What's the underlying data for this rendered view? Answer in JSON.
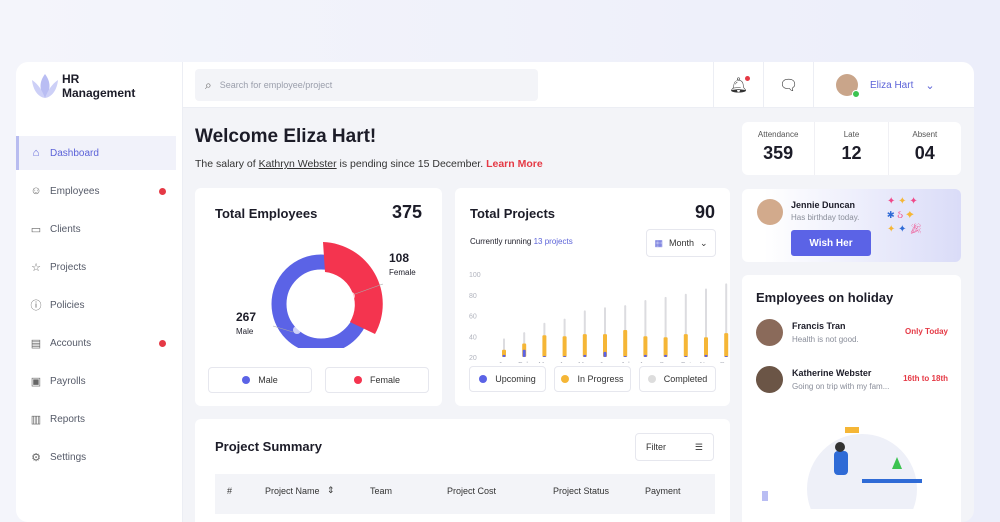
{
  "app": {
    "title_line1": "HR",
    "title_line2": "Management"
  },
  "sidebar": {
    "items": [
      {
        "label": "Dashboard",
        "icon": "home-icon",
        "active": true,
        "badge": false
      },
      {
        "label": "Employees",
        "icon": "user-icon",
        "badge": true
      },
      {
        "label": "Clients",
        "icon": "briefcase-icon",
        "badge": false
      },
      {
        "label": "Projects",
        "icon": "star-icon",
        "badge": false
      },
      {
        "label": "Policies",
        "icon": "info-icon",
        "badge": false
      },
      {
        "label": "Accounts",
        "icon": "wallet-icon",
        "badge": true
      },
      {
        "label": "Payrolls",
        "icon": "money-icon",
        "badge": false
      },
      {
        "label": "Reports",
        "icon": "bar-chart-icon",
        "badge": false
      },
      {
        "label": "Settings",
        "icon": "gear-icon",
        "badge": false
      }
    ]
  },
  "header": {
    "search_placeholder": "Search for employee/project",
    "user_name": "Eliza Hart"
  },
  "welcome": {
    "title": "Welcome Eliza Hart!",
    "msg_pre": "The salary of ",
    "msg_name": "Kathryn Webster",
    "msg_post": " is pending since 15 December. ",
    "learn_more": "Learn More"
  },
  "employees": {
    "title": "Total Employees",
    "total": "375",
    "female_count": "108",
    "female_label": "Female",
    "male_count": "267",
    "male_label": "Male",
    "legend_male": "Male",
    "legend_female": "Female",
    "colors": {
      "male": "#5b63e6",
      "female": "#f4344f"
    }
  },
  "projects": {
    "title": "Total Projects",
    "total": "90",
    "running_pre": "Currently running ",
    "running_link": "13 projects",
    "period": "Month",
    "legend": [
      "Upcoming",
      "In Progress",
      "Completed"
    ]
  },
  "stats": [
    {
      "label": "Attendance",
      "value": "359"
    },
    {
      "label": "Late",
      "value": "12"
    },
    {
      "label": "Absent",
      "value": "04"
    }
  ],
  "birthday": {
    "name": "Jennie Duncan",
    "msg": "Has birthday today.",
    "button": "Wish Her"
  },
  "holiday": {
    "title": "Employees on holiday",
    "items": [
      {
        "name": "Francis Tran",
        "note": "Health is not good.",
        "when": "Only Today"
      },
      {
        "name": "Katherine Webster",
        "note": "Going on trip with my fam...",
        "when": "16th to 18th"
      }
    ]
  },
  "summary": {
    "title": "Project Summary",
    "filter": "Filter",
    "columns": [
      "#",
      "Project Name",
      "Team",
      "Project Cost",
      "Project Status",
      "Payment"
    ]
  },
  "chart_data": {
    "type": "bar",
    "title": "Total Projects",
    "categories": [
      "Jan",
      "Feb",
      "Mar",
      "Apr",
      "May",
      "Jun",
      "Jul",
      "Aug",
      "Sep",
      "Oct",
      "Nov",
      "Dec"
    ],
    "yticks": [
      100,
      80,
      60,
      40,
      20
    ],
    "ylim": [
      20,
      100
    ],
    "series": [
      {
        "name": "Completed",
        "color": "#dcdce0",
        "values": [
          38,
          44,
          53,
          57,
          65,
          68,
          70,
          75,
          78,
          81,
          86,
          91
        ]
      },
      {
        "name": "In Progress",
        "color": "#f5b636",
        "values": [
          27,
          33,
          41,
          40,
          42,
          42,
          46,
          40,
          39,
          42,
          39,
          43
        ]
      },
      {
        "name": "Upcoming",
        "color": "#5b63e6",
        "values": [
          22,
          27,
          21,
          21,
          22,
          25,
          21,
          22,
          22,
          21,
          22,
          21
        ]
      }
    ]
  }
}
